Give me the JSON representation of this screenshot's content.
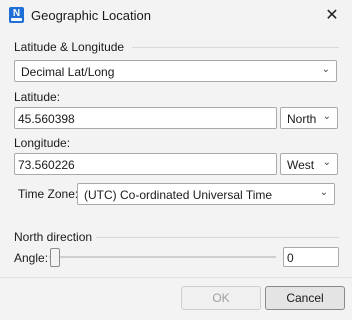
{
  "window": {
    "title": "Geographic Location",
    "app_icon_letter": "N"
  },
  "latlong": {
    "group_label": "Latitude & Longitude",
    "format_value": "Decimal Lat/Long",
    "latitude_label": "Latitude:",
    "latitude_value": "45.560398",
    "latitude_dir": "North",
    "longitude_label": "Longitude:",
    "longitude_value": "73.560226",
    "longitude_dir": "West",
    "timezone_label": "Time Zone:",
    "timezone_value": "(UTC) Co-ordinated Universal Time"
  },
  "north": {
    "group_label": "North direction",
    "angle_label": "Angle:",
    "angle_value": "0",
    "slider_fraction": 0
  },
  "buttons": {
    "ok": "OK",
    "cancel": "Cancel"
  }
}
